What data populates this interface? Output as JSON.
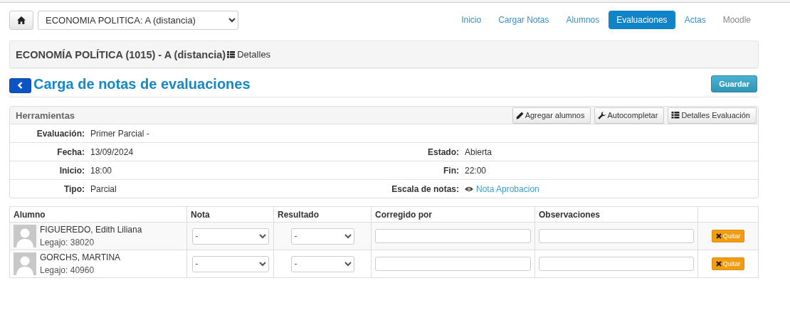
{
  "course_select": {
    "value": "ECONOMIA POLITICA: A (distancia)"
  },
  "nav": [
    {
      "label": "Inicio",
      "selected": false,
      "disabled": false
    },
    {
      "label": "Cargar Notas",
      "selected": false,
      "disabled": false
    },
    {
      "label": "Alumnos",
      "selected": false,
      "disabled": false
    },
    {
      "label": "Evaluaciones",
      "selected": true,
      "disabled": false
    },
    {
      "label": "Actas",
      "selected": false,
      "disabled": false
    },
    {
      "label": "Moodle",
      "selected": false,
      "disabled": true
    }
  ],
  "course_bar": {
    "title": "ECONOMÍA POLÍTICA (1015) - A (distancia)",
    "details_button": "Detalles"
  },
  "page_title": "Carga de notas de evaluaciones",
  "save_button": "Guardar",
  "tools": {
    "title": "Herramientas",
    "buttons": [
      {
        "kind": "pencil",
        "label": "Agregar alumnos"
      },
      {
        "kind": "wrench",
        "label": "Autocompletar"
      },
      {
        "kind": "list",
        "label": "Detalles Evaluación"
      }
    ]
  },
  "info_rows": [
    {
      "left": {
        "label": "Evaluación:",
        "value": "Primer Parcial -"
      }
    },
    {
      "left": {
        "label": "Fecha:",
        "value": "13/09/2024"
      },
      "right": {
        "label": "Estado:",
        "value": "Abierta"
      }
    },
    {
      "left": {
        "label": "Inicio:",
        "value": "18:00"
      },
      "right": {
        "label": "Fin:",
        "value": "22:00"
      }
    },
    {
      "left": {
        "label": "Tipo:",
        "value": "Parcial"
      },
      "right": {
        "label": "Escala de notas:",
        "value": "Nota Aprobacion",
        "kind": "link"
      }
    }
  ],
  "table": {
    "columns": [
      "Alumno",
      "Nota",
      "Resultado",
      "Corregido por",
      "Observaciones"
    ],
    "rows": [
      {
        "name": "FIGUEREDO, Edith Liliana",
        "legajo": "Legajo: 38020",
        "nota": "-",
        "resultado": "-",
        "remove_button": "Quitar"
      },
      {
        "name": "GORCHS, MARTINA",
        "legajo": "Legajo: 40960",
        "nota": "-",
        "resultado": "-",
        "remove_button": "Quitar"
      }
    ]
  }
}
